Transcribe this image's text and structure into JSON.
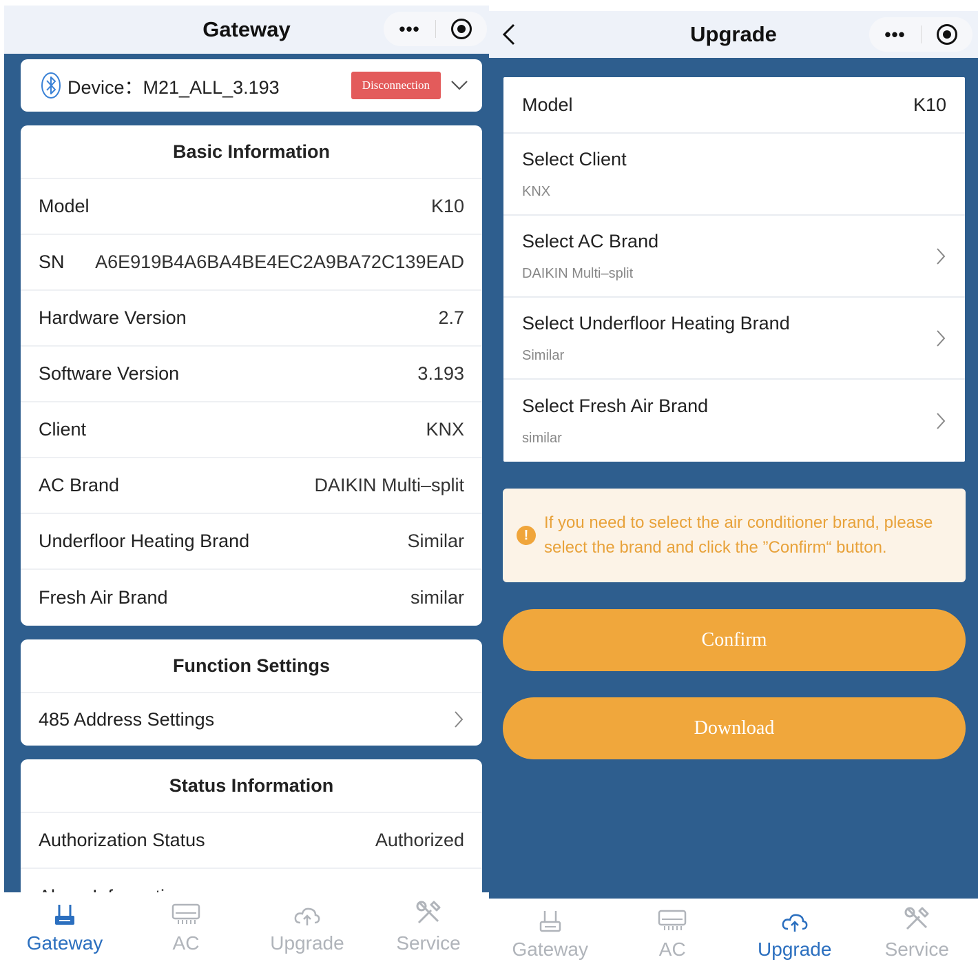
{
  "left": {
    "title": "Gateway",
    "device": {
      "label": "Device：M21_ALL_3.193",
      "status_badge": "Disconnection"
    },
    "basic_info": {
      "title": "Basic Information",
      "rows": [
        {
          "label": "Model",
          "value": "K10"
        },
        {
          "label": "SN",
          "value": "A6E919B4A6BA4BE4EC2A9BA72C139EAD"
        },
        {
          "label": "Hardware Version",
          "value": "2.7"
        },
        {
          "label": "Software Version",
          "value": "3.193"
        },
        {
          "label": "Client",
          "value": "KNX"
        },
        {
          "label": "AC Brand",
          "value": "DAIKIN Multi–split"
        },
        {
          "label": "Underfloor Heating Brand",
          "value": "Similar"
        },
        {
          "label": "Fresh Air Brand",
          "value": "similar"
        }
      ]
    },
    "function_settings": {
      "title": "Function Settings",
      "item": "485 Address Settings"
    },
    "status_info": {
      "title": "Status Information",
      "rows": [
        {
          "label": "Authorization Status",
          "value": "Authorized"
        },
        {
          "label": "Alarm Information",
          "value": ""
        }
      ]
    },
    "tabs": [
      {
        "label": "Gateway",
        "icon": "gateway-icon",
        "active": true
      },
      {
        "label": "AC",
        "icon": "ac-icon",
        "active": false
      },
      {
        "label": "Upgrade",
        "icon": "upgrade-icon",
        "active": false
      },
      {
        "label": "Service",
        "icon": "service-icon",
        "active": false
      }
    ]
  },
  "right": {
    "title": "Upgrade",
    "model": {
      "label": "Model",
      "value": "K10"
    },
    "selects": [
      {
        "label": "Select Client",
        "value": "KNX",
        "chevron": false
      },
      {
        "label": "Select AC Brand",
        "value": "DAIKIN Multi–split",
        "chevron": true
      },
      {
        "label": "Select Underfloor Heating Brand",
        "value": "Similar",
        "chevron": true
      },
      {
        "label": "Select Fresh Air Brand",
        "value": "similar",
        "chevron": true
      }
    ],
    "notice": "If you need to select the air conditioner brand, please select the brand and click the ”Confirm“ button.",
    "confirm_label": "Confirm",
    "download_label": "Download",
    "tabs": [
      {
        "label": "Gateway",
        "icon": "gateway-icon",
        "active": false
      },
      {
        "label": "AC",
        "icon": "ac-icon",
        "active": false
      },
      {
        "label": "Upgrade",
        "icon": "upgrade-icon",
        "active": true
      },
      {
        "label": "Service",
        "icon": "service-icon",
        "active": false
      }
    ]
  },
  "colors": {
    "background_blue": "#2e5e8e",
    "badge_red": "#e35b5b",
    "accent_orange": "#f0a73c",
    "active_tab": "#2b6fbf",
    "inactive_tab": "#b0b4ba"
  }
}
